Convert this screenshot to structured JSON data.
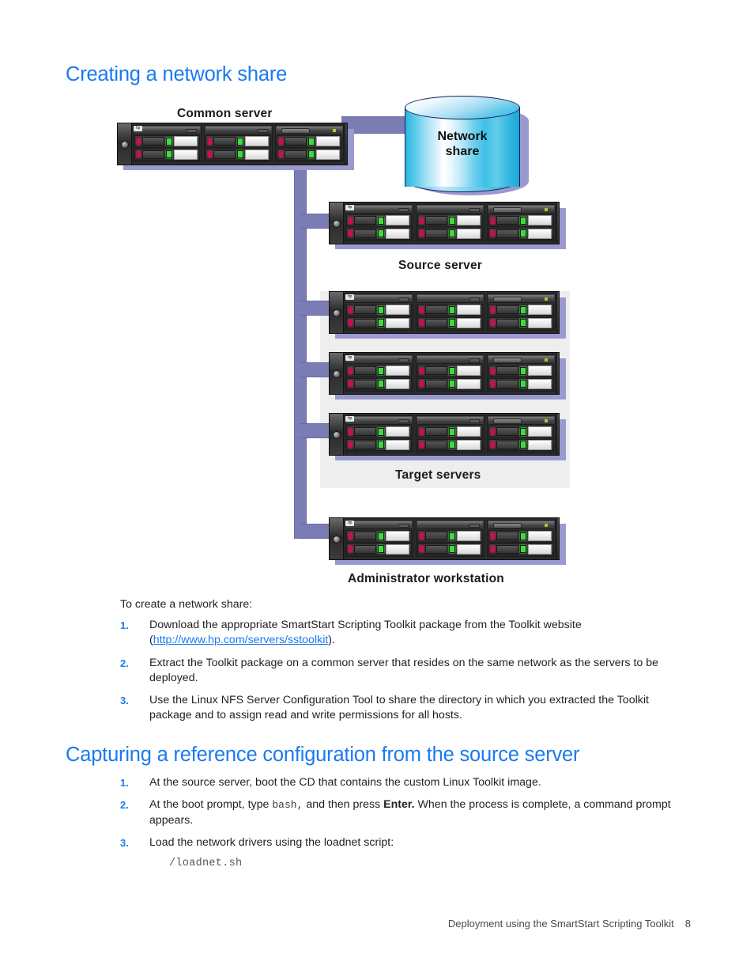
{
  "headings": {
    "network_share": "Creating a network share",
    "capturing": "Capturing a reference configuration from the source server"
  },
  "intro_text": "To create a network share:",
  "network_share_steps": [
    {
      "num": "1.",
      "pre": "Download the appropriate SmartStart Scripting Toolkit package from the Toolkit website (",
      "link": "http://www.hp.com/servers/sstoolkit",
      "post": ")."
    },
    {
      "num": "2.",
      "text": "Extract the Toolkit package on a common server that resides on the same network as the servers to be deployed."
    },
    {
      "num": "3.",
      "text": "Use the Linux NFS Server Configuration Tool to share the directory in which you extracted the Toolkit package and to assign read and write permissions for all hosts."
    }
  ],
  "capturing_steps": [
    {
      "num": "1.",
      "text": "At the source server, boot the CD that contains the custom Linux Toolkit image."
    },
    {
      "num": "2.",
      "pre": "At the boot prompt, type ",
      "mono": "bash,",
      "mid": " and then press ",
      "bold": "Enter.",
      "post": " When the process is complete, a command prompt appears."
    },
    {
      "num": "3.",
      "text": "Load the network drivers using the loadnet script:",
      "code": "/loadnet.sh"
    }
  ],
  "footer": {
    "text": "Deployment using the SmartStart Scripting Toolkit",
    "page": "8"
  },
  "diagram": {
    "captions": {
      "common_server": "Common server",
      "network_share": "Network\nshare",
      "network_share_line1": "Network",
      "network_share_line2": "share",
      "source_server": "Source server",
      "target_servers": "Target servers",
      "admin_workstation": "Administrator workstation"
    },
    "hp_logo": "hp",
    "colors": {
      "bus": "#7b7cb4",
      "bus_shadow": "#9a9ad0",
      "panel": "#eeeeee",
      "cylinder_accent": "#2ab5e0",
      "heading_blue": "#1a7af0",
      "link_blue": "#1a7af0"
    },
    "servers": [
      {
        "name": "common-server"
      },
      {
        "name": "source-server"
      },
      {
        "name": "target-server-1"
      },
      {
        "name": "target-server-2"
      },
      {
        "name": "target-server-3"
      },
      {
        "name": "administrator-workstation"
      }
    ]
  }
}
